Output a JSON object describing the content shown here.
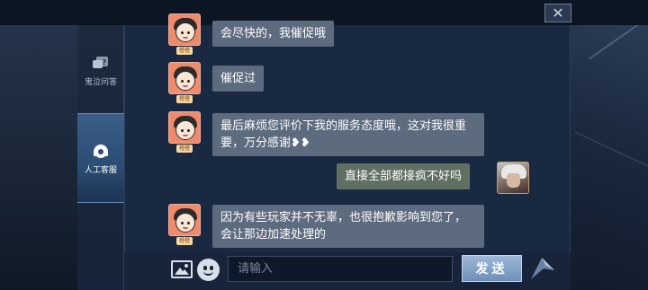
{
  "colors": {
    "bubble_agent": "#5d6b7e",
    "bubble_user": "#5f6f62",
    "accent": "#6e8fb8",
    "avatar_bg": "#f08a6c"
  },
  "window": {
    "close_icon": "close-icon"
  },
  "sidebar": {
    "items": [
      {
        "icon": "question-icon",
        "label": "鬼泣问答"
      },
      {
        "icon": "headset-icon",
        "label": "人工客服"
      }
    ]
  },
  "chat": {
    "agent_tag": "橙橙",
    "messages": [
      {
        "sender": "agent",
        "text": "会尽快的，我催促哦"
      },
      {
        "sender": "agent",
        "text": "催促过"
      },
      {
        "sender": "agent",
        "text": "最后麻烦您评价下我的服务态度哦，这对我很重要，万分感谢❥❥"
      },
      {
        "sender": "user",
        "text": "直接全部都接疯不好吗"
      },
      {
        "sender": "agent",
        "text": "因为有些玩家并不无辜，也很抱歉影响到您了，会让那边加速处理的"
      }
    ]
  },
  "input_bar": {
    "image_icon": "image-icon",
    "emoji_icon": "emoji-icon",
    "placeholder": "请输入",
    "value": "",
    "send_label": "发送"
  }
}
